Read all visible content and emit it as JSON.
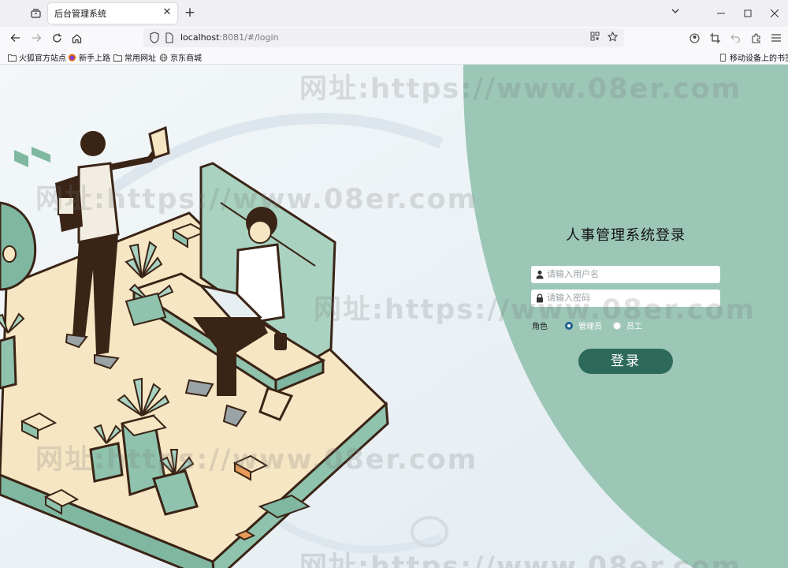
{
  "browser": {
    "tab_title": "后台管理系统",
    "url_host": "localhost",
    "url_rest": ":8081/#/login",
    "bookmarks": [
      "火狐官方站点",
      "新手上路",
      "常用网址",
      "京东商城"
    ],
    "mobile_bookmarks": "移动设备上的书签"
  },
  "login": {
    "title": "人事管理系统登录",
    "username_placeholder": "请输入用户名",
    "password_placeholder": "请输入密码",
    "role_label": "角色",
    "roles": [
      {
        "label": "管理员",
        "checked": true
      },
      {
        "label": "员工",
        "checked": false
      }
    ],
    "submit_label": "登录"
  },
  "watermark": "网址:https://www.08er.com",
  "colors": {
    "panel_green": "#9cc6b6",
    "button_green": "#2e6a5a",
    "radio_checked": "#1f5f8b"
  }
}
